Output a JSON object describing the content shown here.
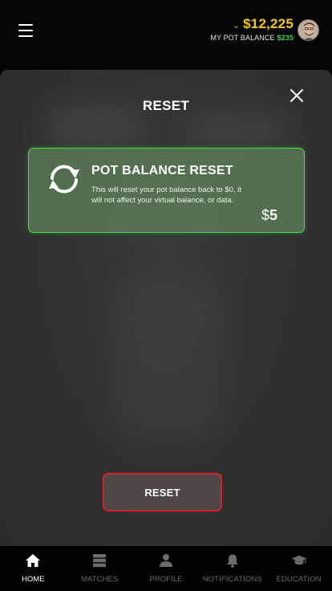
{
  "header": {
    "menu_icon": "hamburger-icon",
    "balance": "$12,225",
    "pot_balance_label": "MY POT BALANCE",
    "pot_balance_value": "$235",
    "accent_yellow": "#f3c623",
    "accent_green": "#35d34a"
  },
  "modal": {
    "title": "RESET",
    "close_icon": "close-icon",
    "card": {
      "icon": "refresh-icon",
      "title": "POT BALANCE RESET",
      "description": "This will reset your pot balance back to $0, it will not affect your virtual balance, or data.",
      "price_symbol": "$",
      "price_value": "5",
      "border_color": "#3fe03b"
    },
    "reset_button": "RESET",
    "reset_border_color": "#d4232b"
  },
  "nav": {
    "items": [
      {
        "label": "HOME",
        "icon": "home-icon",
        "active": true
      },
      {
        "label": "MATCHES",
        "icon": "matches-icon",
        "active": false
      },
      {
        "label": "PROFILE",
        "icon": "profile-icon",
        "active": false
      },
      {
        "label": "NOTIFICATIONS",
        "icon": "bell-icon",
        "active": false
      },
      {
        "label": "EDUCATION",
        "icon": "graduation-cap-icon",
        "active": false
      }
    ]
  }
}
